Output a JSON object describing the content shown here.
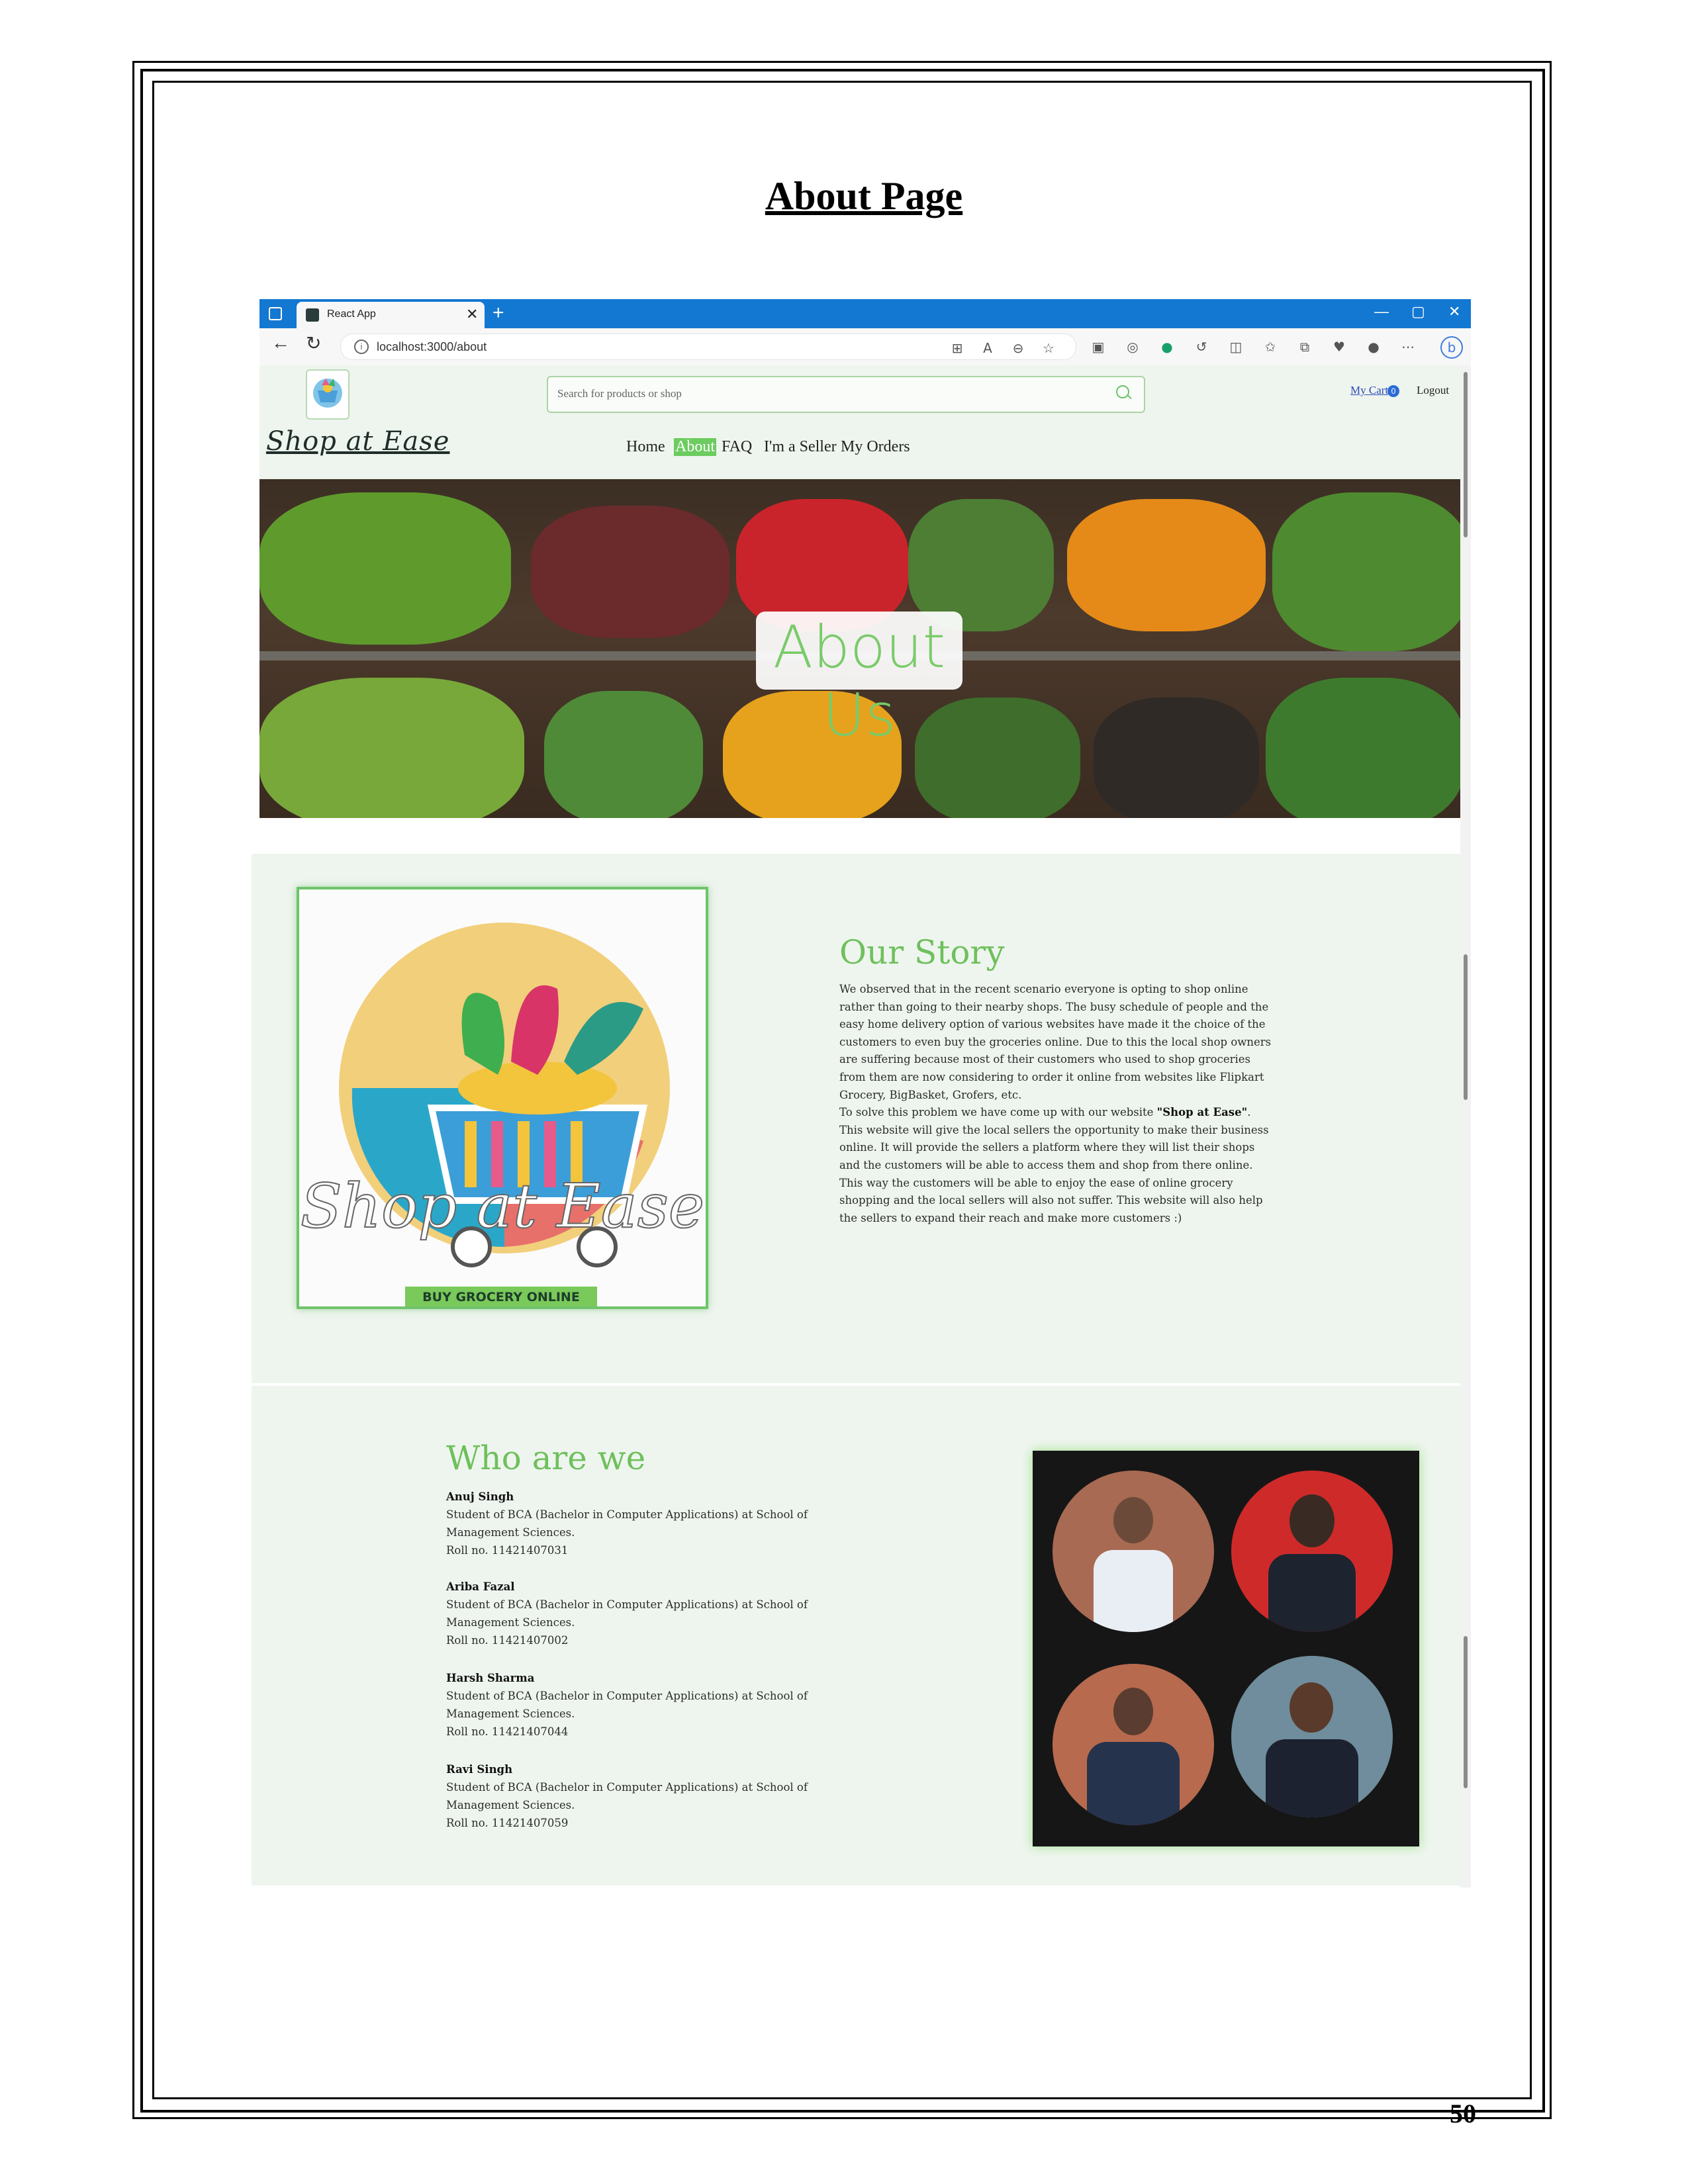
{
  "document": {
    "title": "About Page",
    "page_number": "50"
  },
  "browser": {
    "tab_title": "React App",
    "tab_close": "✕",
    "new_tab": "+",
    "url": "localhost:3000/about",
    "window_controls": [
      "—",
      "▢",
      "✕"
    ]
  },
  "site": {
    "brand": "Shop at Ease",
    "search_placeholder": "Search for products or shop",
    "cart_label": "My Cart",
    "cart_count": "0",
    "logout_label": "Logout",
    "nav": [
      "Home",
      "About",
      "FAQ",
      "I'm a Seller",
      "My Orders"
    ],
    "active_nav": "About",
    "hero_text": "About Us",
    "story": {
      "title": "Our Story",
      "p1": "We observed that in the recent scenario everyone is opting to shop online rather than going to their nearby shops. The busy schedule of people and the easy home delivery option of various websites have made it the choice of the customers to even buy the groceries online. Due to this the local shop owners are suffering because most of their customers who used to shop groceries from them are now considering to order it online from websites like Flipkart Grocery, BigBasket, Grofers, etc.",
      "p2_pre": "To solve this problem we have come up with our website ",
      "p2_bold": "\"Shop at Ease\"",
      "p2_post": ". This website will give the local sellers the opportunity to make their business online. It will provide the sellers a platform where they will list their shops and the customers will be able to access them and shop from there online.",
      "p3": "This way the customers will be able to enjoy the ease of online grocery shopping and the local sellers will also not suffer. This website will also help the sellers to expand their reach and make more customers :)"
    },
    "logo_text": "Shop at Ease",
    "logo_tagline": "BUY GROCERY ONLINE",
    "who": {
      "title": "Who are we",
      "members": [
        {
          "name": "Anuj Singh",
          "desc": "Student of BCA (Bachelor in Computer Applications) at School of Management Sciences.",
          "roll": "Roll no. 11421407031"
        },
        {
          "name": "Ariba Fazal",
          "desc": "Student of BCA (Bachelor in Computer Applications) at School of Management Sciences.",
          "roll": "Roll no. 11421407002"
        },
        {
          "name": "Harsh Sharma",
          "desc": "Student of BCA (Bachelor in Computer Applications) at School of Management Sciences.",
          "roll": "Roll no. 11421407044"
        },
        {
          "name": "Ravi Singh",
          "desc": "Student of BCA (Bachelor in Computer Applications) at School of Management Sciences.",
          "roll": "Roll no. 11421407059"
        }
      ]
    }
  },
  "colors": {
    "accent_green": "#6fc05c",
    "browser_blue": "#1278d2",
    "section_bg": "#eef5ee"
  }
}
